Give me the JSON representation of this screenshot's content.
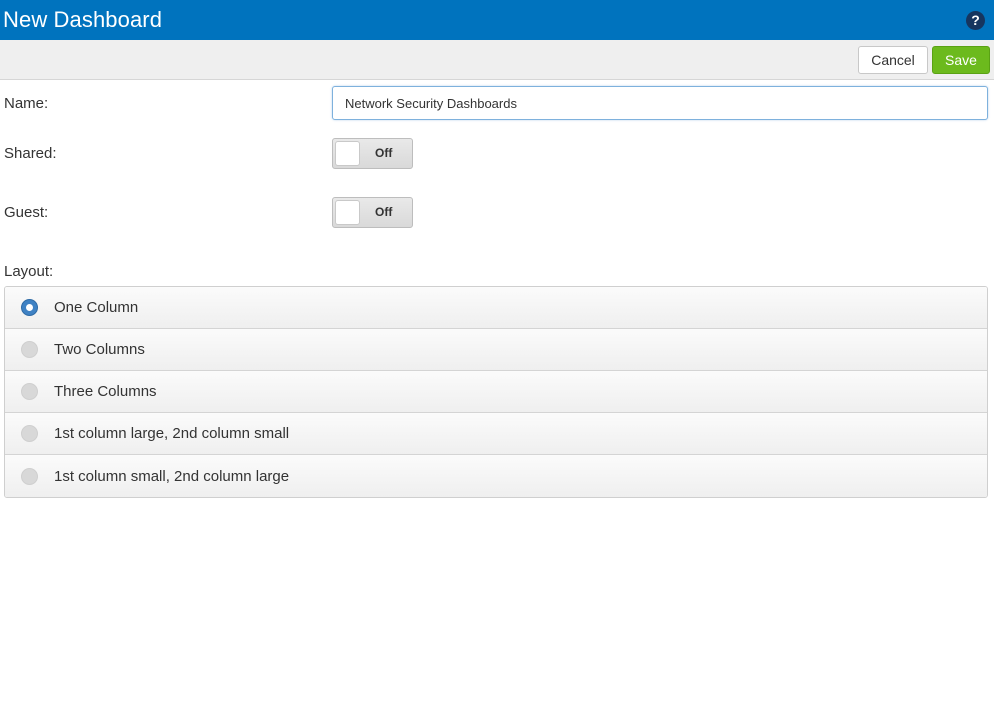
{
  "theme": {
    "accent": "#0073be",
    "save_green": "#6cba1d"
  },
  "header": {
    "title": "New Dashboard",
    "help_icon": "question-circle-icon"
  },
  "toolbar": {
    "cancel_label": "Cancel",
    "save_label": "Save"
  },
  "form": {
    "name_label": "Name:",
    "name_value": "Network Security Dashboards",
    "shared_label": "Shared:",
    "shared_state": "Off",
    "guest_label": "Guest:",
    "guest_state": "Off",
    "layout_label": "Layout:",
    "layout_options": [
      {
        "label": "One Column",
        "selected": true
      },
      {
        "label": "Two Columns",
        "selected": false
      },
      {
        "label": "Three Columns",
        "selected": false
      },
      {
        "label": "1st column large, 2nd column small",
        "selected": false
      },
      {
        "label": "1st column small, 2nd column large",
        "selected": false
      }
    ]
  }
}
